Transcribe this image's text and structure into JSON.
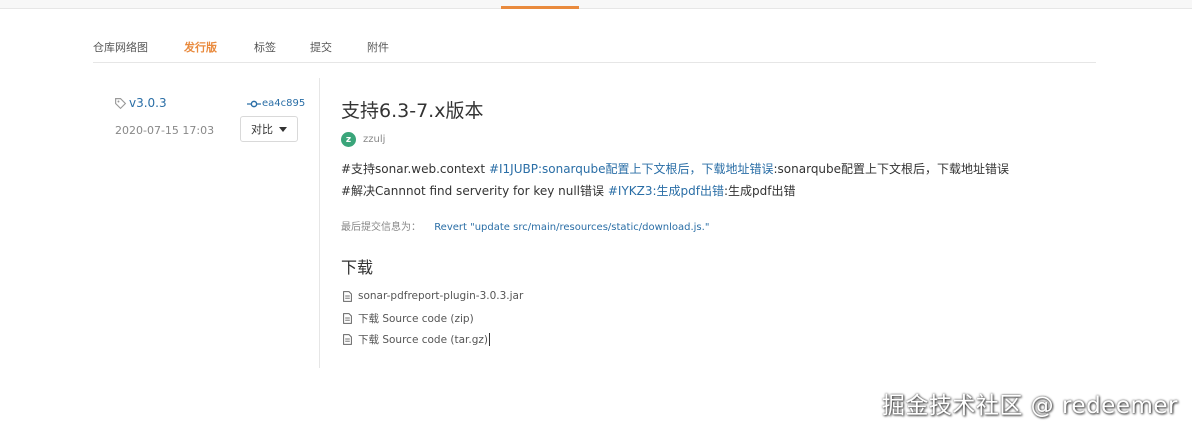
{
  "tabs": [
    {
      "label": "仓库网络图",
      "active": false
    },
    {
      "label": "发行版",
      "active": true
    },
    {
      "label": "标签",
      "active": false
    },
    {
      "label": "提交",
      "active": false
    },
    {
      "label": "附件",
      "active": false
    }
  ],
  "release": {
    "tag": "v3.0.3",
    "commit": "ea4c895",
    "date": "2020-07-15 17:03",
    "compare_label": "对比",
    "title": "支持6.3-7.x版本",
    "author_initial": "z",
    "author": "zzulj",
    "desc_line1": {
      "part1": "#支持sonar.web.context ",
      "link1": "#I1JUBP:sonarqube配置上下文根后，下载地址错误",
      "part2": ":sonarqube配置上下文根后，下载地址错误"
    },
    "desc_line2": {
      "part1": "#解决Cannnot find serverity for key null错误 ",
      "link1": "#IYKZ3:生成pdf出错",
      "part2": ":生成pdf出错"
    },
    "last_commit_label": "最后提交信息为：",
    "last_commit_message": "Revert \"update src/main/resources/static/download.js.\""
  },
  "downloads": {
    "heading": "下载",
    "files": [
      "sonar-pdfreport-plugin-3.0.3.jar",
      "下载 Source code (zip)",
      "下载 Source code (tar.gz)"
    ]
  },
  "watermark": "掘金技术社区 @ redeemer",
  "colors": {
    "accent": "#e98a3d",
    "link": "#2a6ea6",
    "avatar": "#3aa57a"
  }
}
